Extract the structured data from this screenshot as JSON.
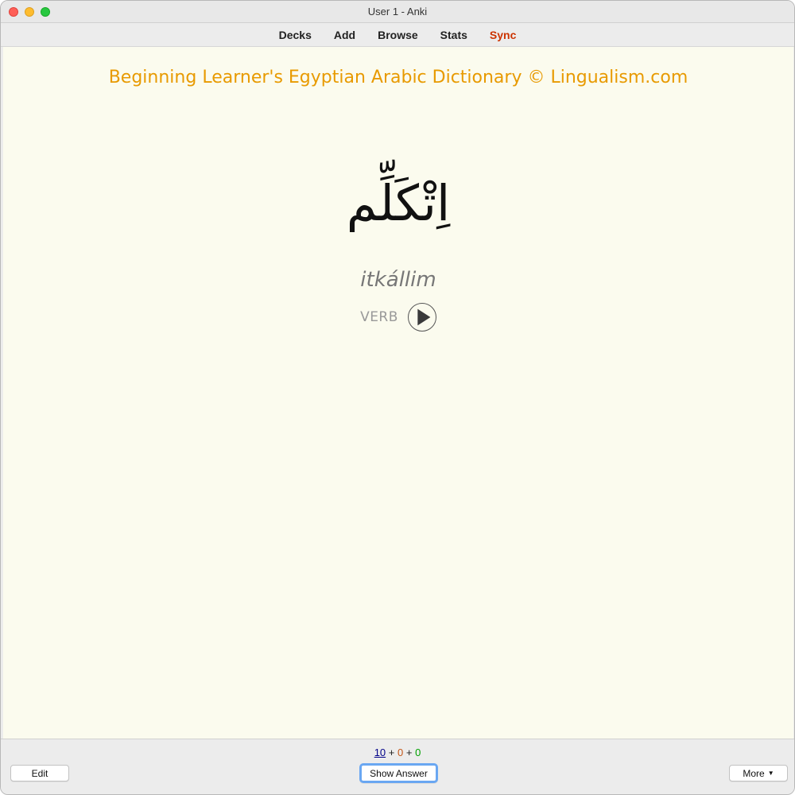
{
  "window": {
    "title": "User 1 - Anki"
  },
  "toolbar": {
    "decks": "Decks",
    "add": "Add",
    "browse": "Browse",
    "stats": "Stats",
    "sync": "Sync"
  },
  "card": {
    "header": "Beginning Learner's Egyptian Arabic Dictionary © Lingualism.com",
    "arabic": "اِتْكَلِّم",
    "transliteration": "itkállim",
    "part_of_speech": "VERB",
    "play_icon": "play-icon"
  },
  "bottom": {
    "count_new": "10",
    "count_learning": "0",
    "count_review": "0",
    "plus": "+",
    "edit_label": "Edit",
    "show_answer_label": "Show Answer",
    "more_label": "More",
    "more_icon": "caret-down-icon"
  },
  "colors": {
    "header": "#e89a00",
    "sync": "#cc3300",
    "card_bg": "#fbfbee",
    "new_count": "#000088",
    "learning_count": "#c35617",
    "review_count": "#00a000"
  }
}
